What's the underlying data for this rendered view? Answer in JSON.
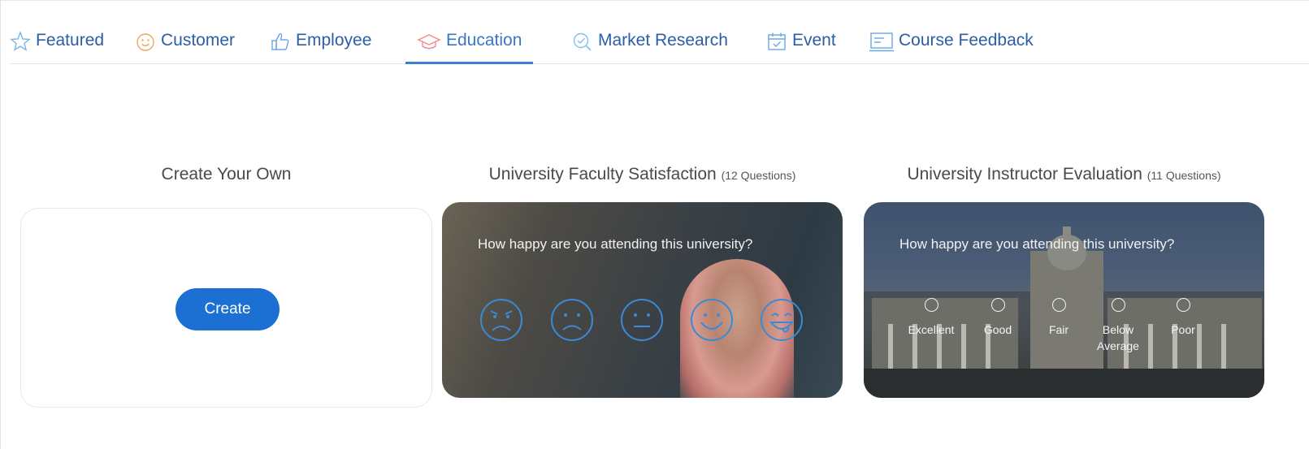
{
  "tabs": [
    {
      "label": "Featured",
      "icon": "star-icon",
      "color": "#7fb6e8"
    },
    {
      "label": "Customer",
      "icon": "smiley-icon",
      "color": "#f2a65a"
    },
    {
      "label": "Employee",
      "icon": "thumbs-up-icon",
      "color": "#6aa8e0"
    },
    {
      "label": "Education",
      "icon": "graduation-cap-icon",
      "color": "#f08a8a"
    },
    {
      "label": "Market Research",
      "icon": "magnifier-check-icon",
      "color": "#7fc3e8"
    },
    {
      "label": "Event",
      "icon": "calendar-check-icon",
      "color": "#6aa8e0"
    },
    {
      "label": "Course Feedback",
      "icon": "slides-icon",
      "color": "#6aa8e0"
    }
  ],
  "active_tab": "Education",
  "cards": [
    {
      "title": "Create Your Own",
      "button_label": "Create"
    },
    {
      "title": "University Faculty Satisfaction",
      "questions": "(12 Questions)",
      "prompt": "How happy are you attending this university?",
      "faces": [
        "angry-face-icon",
        "sad-face-icon",
        "neutral-face-icon",
        "smile-face-icon",
        "happy-face-icon"
      ]
    },
    {
      "title": "University Instructor Evaluation",
      "questions": "(11 Questions)",
      "prompt": "How happy are you attending this university?",
      "options": [
        "Excellent",
        "Good",
        "Fair",
        "Below Average",
        "Poor"
      ]
    }
  ]
}
